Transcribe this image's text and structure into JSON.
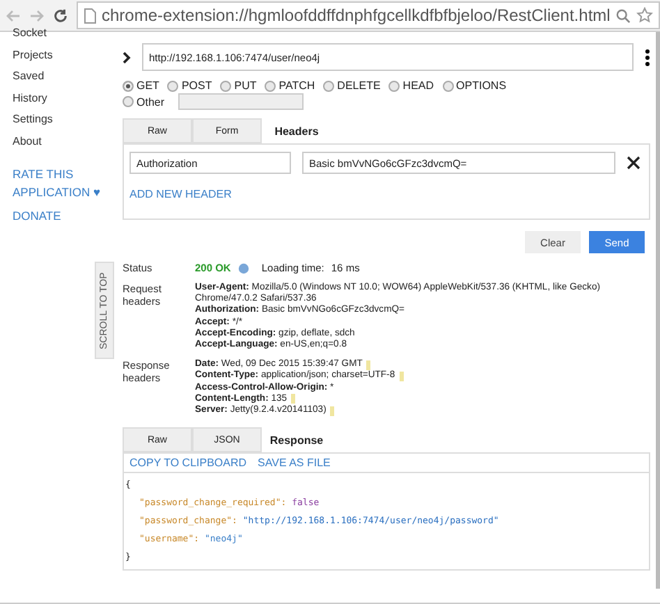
{
  "browser": {
    "address": "chrome-extension://hgmloofddffdnphfgcellkdfbfbjeloo/RestClient.html"
  },
  "sidebar": {
    "items": [
      {
        "label": "Socket"
      },
      {
        "label": "Projects"
      },
      {
        "label": "Saved"
      },
      {
        "label": "History"
      },
      {
        "label": "Settings"
      },
      {
        "label": "About"
      }
    ],
    "links": [
      {
        "label": "RATE THIS APPLICATION ♥"
      },
      {
        "label": "DONATE"
      }
    ]
  },
  "request": {
    "url": "http://192.168.1.106:7474/user/neo4j",
    "methods": [
      {
        "label": "GET",
        "selected": true
      },
      {
        "label": "POST",
        "selected": false
      },
      {
        "label": "PUT",
        "selected": false
      },
      {
        "label": "PATCH",
        "selected": false
      },
      {
        "label": "DELETE",
        "selected": false
      },
      {
        "label": "HEAD",
        "selected": false
      },
      {
        "label": "OPTIONS",
        "selected": false
      },
      {
        "label": "Other",
        "selected": false
      }
    ],
    "tabs": [
      {
        "label": "Raw",
        "selected": false
      },
      {
        "label": "Form",
        "selected": false
      },
      {
        "label": "Headers",
        "selected": true
      }
    ],
    "headers": [
      {
        "name": "Authorization",
        "value": "Basic bmVvNGo6cGFzc3dvcmQ="
      }
    ],
    "add_header": "ADD NEW HEADER",
    "buttons": [
      {
        "label": "Clear",
        "kind": "secondary"
      },
      {
        "label": "Send",
        "kind": "primary"
      }
    ]
  },
  "scroll_to_top": "SCROLL TO TOP",
  "result": {
    "status_label": "Status",
    "status": "200 OK",
    "loading_label": "Loading time:",
    "loading_time": "16 ms",
    "request_headers_label": "Request headers",
    "request_headers": [
      {
        "name": "User-Agent:",
        "value": "Mozilla/5.0 (Windows NT 10.0; WOW64) AppleWebKit/537.36 (KHTML, like Gecko) Chrome/47.0.2 Safari/537.36"
      },
      {
        "name": "Authorization:",
        "value": "Basic bmVvNGo6cGFzc3dvcmQ="
      },
      {
        "name": "Accept:",
        "value": "*/*"
      },
      {
        "name": "Accept-Encoding:",
        "value": "gzip, deflate, sdch"
      },
      {
        "name": "Accept-Language:",
        "value": "en-US,en;q=0.8"
      }
    ],
    "response_headers_label": "Response headers",
    "response_headers": [
      {
        "name": "Date:",
        "value": "Wed, 09 Dec 2015 15:39:47 GMT",
        "hint": true
      },
      {
        "name": "Content-Type:",
        "value": "application/json; charset=UTF-8",
        "hint": true
      },
      {
        "name": "Access-Control-Allow-Origin:",
        "value": "*",
        "hint": false
      },
      {
        "name": "Content-Length:",
        "value": "135",
        "hint": true
      },
      {
        "name": "Server:",
        "value": "Jetty(9.2.4.v20141103)",
        "hint": true
      }
    ]
  },
  "response": {
    "tabs": [
      {
        "label": "Raw",
        "selected": false
      },
      {
        "label": "JSON",
        "selected": false
      },
      {
        "label": "Response",
        "selected": true
      }
    ],
    "actions": [
      {
        "label": "COPY TO CLIPBOARD"
      },
      {
        "label": "SAVE AS FILE"
      }
    ],
    "open_brace": "{",
    "close_brace": "}",
    "fields": [
      {
        "key": "\"password_change_required\":",
        "value": "false",
        "kind": "boolean"
      },
      {
        "key": "\"password_change\":",
        "value": "\"http://192.168.1.106:7474/user/neo4j/password\"",
        "kind": "link"
      },
      {
        "key": "\"username\":",
        "value": "\"neo4j\"",
        "kind": "string"
      }
    ]
  }
}
